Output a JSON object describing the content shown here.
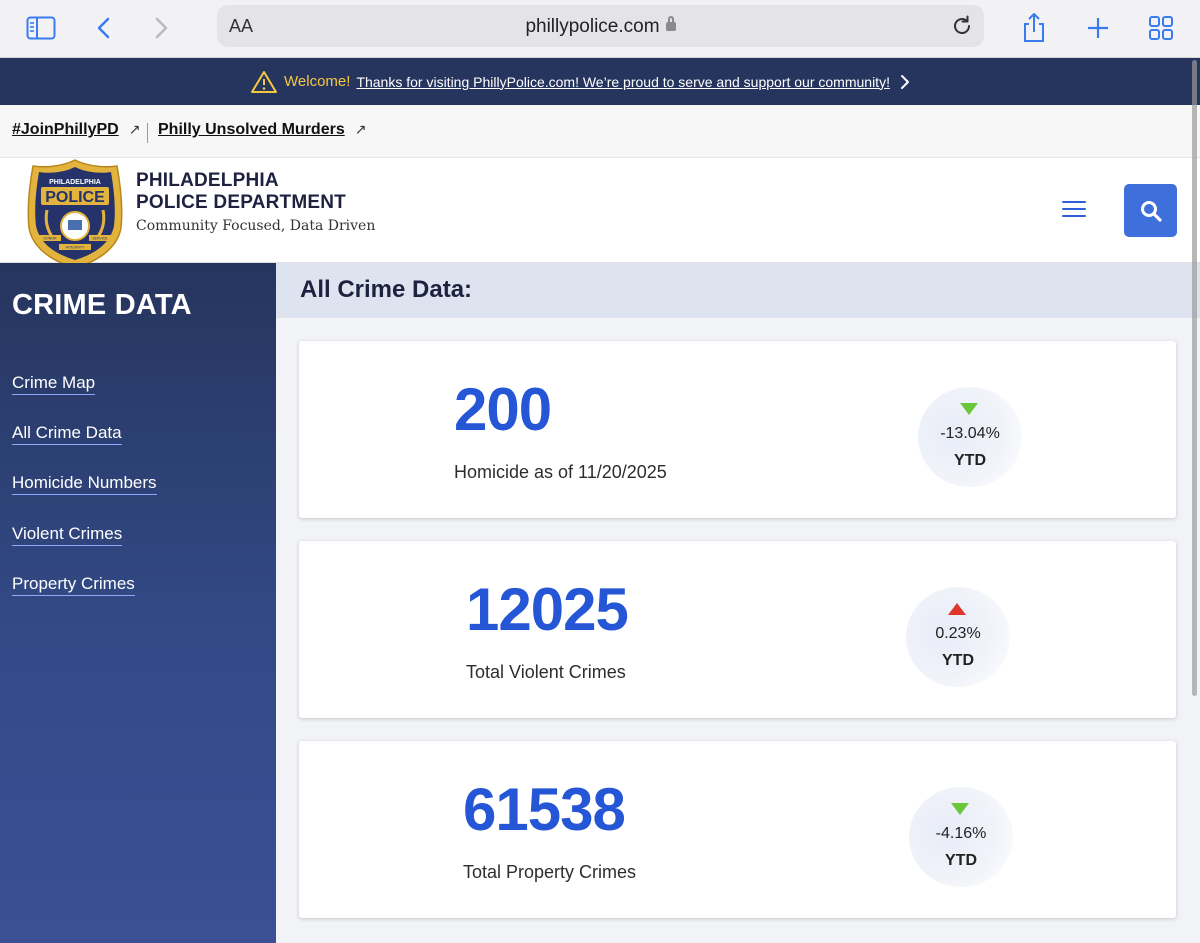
{
  "browser": {
    "address_size_label": "AA",
    "url": "phillypolice.com"
  },
  "announcement": {
    "welcome": "Welcome!",
    "message": "Thanks for visiting PhillyPolice.com! We’re proud to serve and support our community!"
  },
  "utility_links": [
    {
      "label": "#JoinPhillyPD",
      "icon": "external-link-arrow"
    },
    {
      "label": "Philly Unsolved Murders",
      "icon": "external-link-arrow"
    }
  ],
  "header": {
    "badge": {
      "top_text": "PHILADELPHIA",
      "main_text": "POLICE",
      "left_ribbon": "HONOR",
      "right_ribbon": "SERVICE",
      "bottom_ribbon": "INTEGRITY"
    },
    "dept_line1": "PHILADELPHIA",
    "dept_line2": "POLICE DEPARTMENT",
    "tagline": "Community Focused, Data Driven"
  },
  "sidebar": {
    "title": "CRIME DATA",
    "items": [
      {
        "label": "Crime Map"
      },
      {
        "label": "All Crime Data"
      },
      {
        "label": "Homicide Numbers"
      },
      {
        "label": "Violent Crimes"
      },
      {
        "label": "Property Crimes"
      }
    ]
  },
  "main": {
    "title": "All Crime Data:",
    "cards": [
      {
        "value": "200",
        "label": "Homicide as of 11/20/2025",
        "change": "-13.04%",
        "period": "YTD",
        "direction": "down",
        "color": "#6cc63a"
      },
      {
        "value": "12025",
        "label": "Total Violent Crimes",
        "change": "0.23%",
        "period": "YTD",
        "direction": "up",
        "color": "#e0352b"
      },
      {
        "value": "61538",
        "label": "Total Property Crimes",
        "change": "-4.16%",
        "period": "YTD",
        "direction": "down",
        "color": "#6cc63a"
      }
    ]
  },
  "colors": {
    "navy": "#26355e",
    "accent_blue": "#2456d6",
    "search_button": "#3f6fdb",
    "welcome_yellow": "#f5c842"
  }
}
